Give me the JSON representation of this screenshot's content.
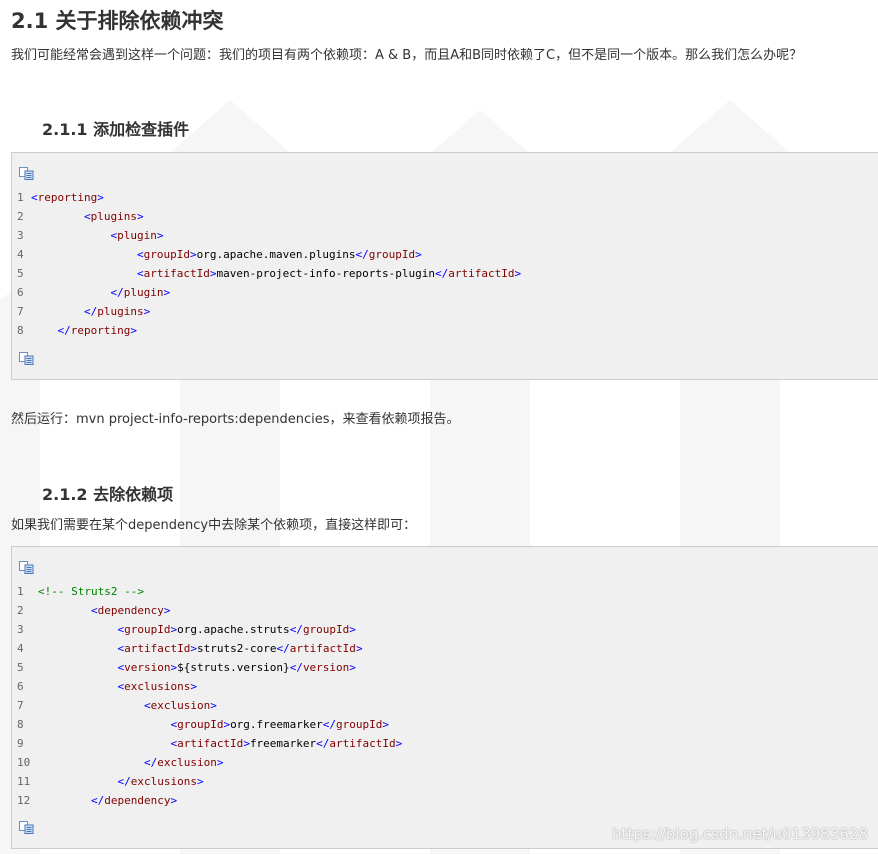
{
  "section": {
    "title": "2.1 关于排除依赖冲突",
    "intro": "我们可能经常会遇到这样一个问题：我们的项目有两个依赖项：A & B，而且A和B同时依赖了C，但不是同一个版本。那么我们怎么办呢？"
  },
  "sub1": {
    "title": "2.1.1 添加检查插件",
    "code": [
      {
        "n": "1",
        "indent": "",
        "parts": [
          {
            "c": "tb",
            "t": "<"
          },
          {
            "c": "tn",
            "t": "reporting"
          },
          {
            "c": "tb",
            "t": ">"
          }
        ]
      },
      {
        "n": "2",
        "indent": "        ",
        "parts": [
          {
            "c": "tb",
            "t": "<"
          },
          {
            "c": "tn",
            "t": "plugins"
          },
          {
            "c": "tb",
            "t": ">"
          }
        ]
      },
      {
        "n": "3",
        "indent": "            ",
        "parts": [
          {
            "c": "tb",
            "t": "<"
          },
          {
            "c": "tn",
            "t": "plugin"
          },
          {
            "c": "tb",
            "t": ">"
          }
        ]
      },
      {
        "n": "4",
        "indent": "                ",
        "parts": [
          {
            "c": "tb",
            "t": "<"
          },
          {
            "c": "tn",
            "t": "groupId"
          },
          {
            "c": "tb",
            "t": ">"
          },
          {
            "c": "tx",
            "t": "org.apache.maven.plugins"
          },
          {
            "c": "tb",
            "t": "</"
          },
          {
            "c": "tn",
            "t": "groupId"
          },
          {
            "c": "tb",
            "t": ">"
          }
        ]
      },
      {
        "n": "5",
        "indent": "                ",
        "parts": [
          {
            "c": "tb",
            "t": "<"
          },
          {
            "c": "tn",
            "t": "artifactId"
          },
          {
            "c": "tb",
            "t": ">"
          },
          {
            "c": "tx",
            "t": "maven-project-info-reports-plugin"
          },
          {
            "c": "tb",
            "t": "</"
          },
          {
            "c": "tn",
            "t": "artifactId"
          },
          {
            "c": "tb",
            "t": ">"
          }
        ]
      },
      {
        "n": "6",
        "indent": "            ",
        "parts": [
          {
            "c": "tb",
            "t": "</"
          },
          {
            "c": "tn",
            "t": "plugin"
          },
          {
            "c": "tb",
            "t": ">"
          }
        ]
      },
      {
        "n": "7",
        "indent": "        ",
        "parts": [
          {
            "c": "tb",
            "t": "</"
          },
          {
            "c": "tn",
            "t": "plugins"
          },
          {
            "c": "tb",
            "t": ">"
          }
        ]
      },
      {
        "n": "8",
        "indent": "    ",
        "parts": [
          {
            "c": "tb",
            "t": "</"
          },
          {
            "c": "tn",
            "t": "reporting"
          },
          {
            "c": "tb",
            "t": ">"
          }
        ]
      }
    ]
  },
  "run_text": "然后运行：mvn project-info-reports:dependencies，来查看依赖项报告。",
  "sub2": {
    "title": "2.1.2 去除依赖项",
    "intro": "如果我们需要在某个dependency中去除某个依赖项，直接这样即可：",
    "code": [
      {
        "n": "1",
        "indent": "",
        "parts": [
          {
            "c": "cm",
            "t": "<!-- Struts2 -->"
          }
        ]
      },
      {
        "n": "2",
        "indent": "        ",
        "parts": [
          {
            "c": "tb",
            "t": "<"
          },
          {
            "c": "tn",
            "t": "dependency"
          },
          {
            "c": "tb",
            "t": ">"
          }
        ]
      },
      {
        "n": "3",
        "indent": "            ",
        "parts": [
          {
            "c": "tb",
            "t": "<"
          },
          {
            "c": "tn",
            "t": "groupId"
          },
          {
            "c": "tb",
            "t": ">"
          },
          {
            "c": "tx",
            "t": "org.apache.struts"
          },
          {
            "c": "tb",
            "t": "</"
          },
          {
            "c": "tn",
            "t": "groupId"
          },
          {
            "c": "tb",
            "t": ">"
          }
        ]
      },
      {
        "n": "4",
        "indent": "            ",
        "parts": [
          {
            "c": "tb",
            "t": "<"
          },
          {
            "c": "tn",
            "t": "artifactId"
          },
          {
            "c": "tb",
            "t": ">"
          },
          {
            "c": "tx",
            "t": "struts2-core"
          },
          {
            "c": "tb",
            "t": "</"
          },
          {
            "c": "tn",
            "t": "artifactId"
          },
          {
            "c": "tb",
            "t": ">"
          }
        ]
      },
      {
        "n": "5",
        "indent": "            ",
        "parts": [
          {
            "c": "tb",
            "t": "<"
          },
          {
            "c": "tn",
            "t": "version"
          },
          {
            "c": "tb",
            "t": ">"
          },
          {
            "c": "tx",
            "t": "${struts.version}"
          },
          {
            "c": "tb",
            "t": "</"
          },
          {
            "c": "tn",
            "t": "version"
          },
          {
            "c": "tb",
            "t": ">"
          }
        ]
      },
      {
        "n": "6",
        "indent": "            ",
        "parts": [
          {
            "c": "tb",
            "t": "<"
          },
          {
            "c": "tn",
            "t": "exclusions"
          },
          {
            "c": "tb",
            "t": ">"
          }
        ]
      },
      {
        "n": "7",
        "indent": "                ",
        "parts": [
          {
            "c": "tb",
            "t": "<"
          },
          {
            "c": "tn",
            "t": "exclusion"
          },
          {
            "c": "tb",
            "t": ">"
          }
        ]
      },
      {
        "n": "8",
        "indent": "                    ",
        "parts": [
          {
            "c": "tb",
            "t": "<"
          },
          {
            "c": "tn",
            "t": "groupId"
          },
          {
            "c": "tb",
            "t": ">"
          },
          {
            "c": "tx",
            "t": "org.freemarker"
          },
          {
            "c": "tb",
            "t": "</"
          },
          {
            "c": "tn",
            "t": "groupId"
          },
          {
            "c": "tb",
            "t": ">"
          }
        ]
      },
      {
        "n": "9",
        "indent": "                    ",
        "parts": [
          {
            "c": "tb",
            "t": "<"
          },
          {
            "c": "tn",
            "t": "artifactId"
          },
          {
            "c": "tb",
            "t": ">"
          },
          {
            "c": "tx",
            "t": "freemarker"
          },
          {
            "c": "tb",
            "t": "</"
          },
          {
            "c": "tn",
            "t": "artifactId"
          },
          {
            "c": "tb",
            "t": ">"
          }
        ]
      },
      {
        "n": "10",
        "indent": "                ",
        "parts": [
          {
            "c": "tb",
            "t": "</"
          },
          {
            "c": "tn",
            "t": "exclusion"
          },
          {
            "c": "tb",
            "t": ">"
          }
        ]
      },
      {
        "n": "11",
        "indent": "            ",
        "parts": [
          {
            "c": "tb",
            "t": "</"
          },
          {
            "c": "tn",
            "t": "exclusions"
          },
          {
            "c": "tb",
            "t": ">"
          }
        ]
      },
      {
        "n": "12",
        "indent": "        ",
        "parts": [
          {
            "c": "tb",
            "t": "</"
          },
          {
            "c": "tn",
            "t": "dependency"
          },
          {
            "c": "tb",
            "t": ">"
          }
        ]
      }
    ]
  },
  "watermark": "https://blog.csdn.net/u013983628",
  "icons": {
    "copy": "copy-code-icon"
  }
}
